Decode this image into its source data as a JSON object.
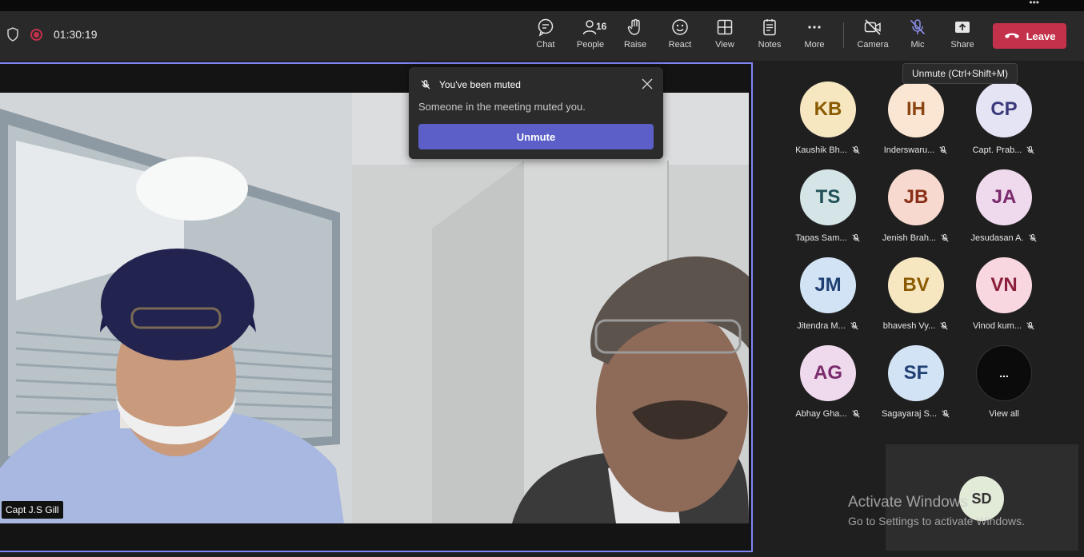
{
  "meeting": {
    "elapsed": "01:30:19"
  },
  "toolbar": {
    "chat": "Chat",
    "people": "People",
    "people_count": "16",
    "raise": "Raise",
    "react": "React",
    "view": "View",
    "notes": "Notes",
    "more": "More",
    "camera": "Camera",
    "mic": "Mic",
    "share": "Share",
    "leave": "Leave"
  },
  "tooltip": "Unmute (Ctrl+Shift+M)",
  "toast": {
    "title": "You've been muted",
    "message": "Someone in the meeting muted you.",
    "button": "Unmute"
  },
  "stage": {
    "speaker_name": "Capt J.S Gill"
  },
  "participants": [
    {
      "initials": "KB",
      "name": "Kaushik Bh...",
      "bg": "#f6e7c1",
      "fg": "#8a5a00"
    },
    {
      "initials": "IH",
      "name": "Inderswaru...",
      "bg": "#fbe6d3",
      "fg": "#8b4513"
    },
    {
      "initials": "CP",
      "name": "Capt. Prab...",
      "bg": "#e5e4f5",
      "fg": "#3b3a7a"
    },
    {
      "initials": "TS",
      "name": "Tapas Sam...",
      "bg": "#d5e4e6",
      "fg": "#1f4f57"
    },
    {
      "initials": "JB",
      "name": "Jenish Brah...",
      "bg": "#f7d9cf",
      "fg": "#8a2f17"
    },
    {
      "initials": "JA",
      "name": "Jesudasan A.",
      "bg": "#efd9ec",
      "fg": "#7a2a6c"
    },
    {
      "initials": "JM",
      "name": "Jitendra M...",
      "bg": "#d2e3f5",
      "fg": "#1f3f73"
    },
    {
      "initials": "BV",
      "name": "bhavesh Vy...",
      "bg": "#f6e7c1",
      "fg": "#8a5a00"
    },
    {
      "initials": "VN",
      "name": "Vinod kum...",
      "bg": "#f8d7e0",
      "fg": "#8a1f3a"
    },
    {
      "initials": "AG",
      "name": "Abhay Gha...",
      "bg": "#efd9ec",
      "fg": "#7a2a6c"
    },
    {
      "initials": "SF",
      "name": "Sagayaraj S...",
      "bg": "#d2e3f5",
      "fg": "#1f3f73"
    }
  ],
  "view_all": {
    "glyph": "...",
    "label": "View all"
  },
  "self_view": {
    "initials": "SD"
  },
  "watermark": {
    "line1": "Activate Windows",
    "line2": "Go to Settings to activate Windows."
  }
}
